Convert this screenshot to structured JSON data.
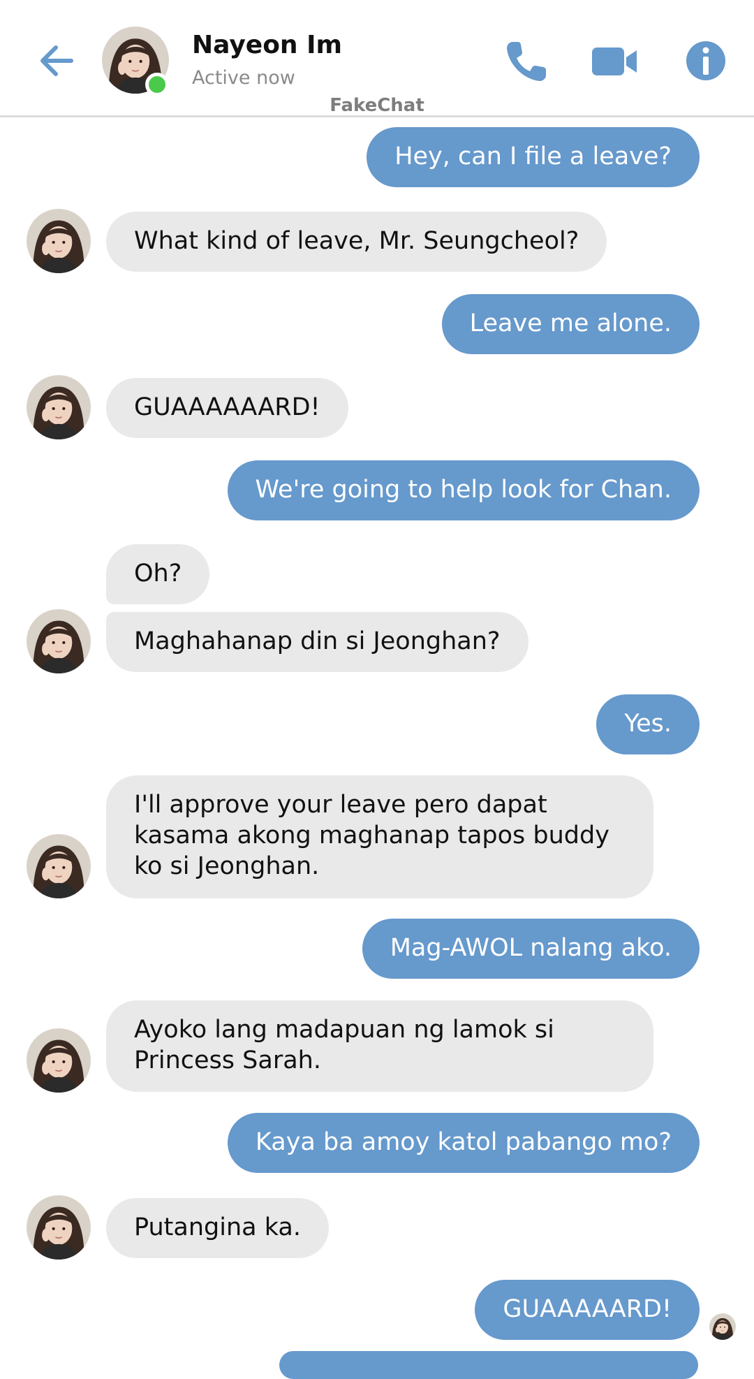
{
  "header": {
    "contact_name": "Nayeon Im",
    "status": "Active now",
    "watermark": "FakeChat",
    "icons": {
      "back": "arrow-left-icon",
      "call": "phone-icon",
      "video": "video-camera-icon",
      "info": "info-icon"
    }
  },
  "colors": {
    "accent": "#6699cc",
    "incoming_bubble": "#e9e9e9",
    "online": "#4bc94b"
  },
  "messages": [
    {
      "dir": "out",
      "text": "Hey, can I file a leave?"
    },
    {
      "dir": "in",
      "text": "What kind of leave, Mr. Seungcheol?"
    },
    {
      "dir": "out",
      "text": "Leave me alone."
    },
    {
      "dir": "in",
      "text": "GUAAAAAARD!"
    },
    {
      "dir": "out",
      "text": "We're going to help look for Chan."
    },
    {
      "dir": "in",
      "text": "Oh?"
    },
    {
      "dir": "in",
      "text": "Maghahanap din si Jeonghan?"
    },
    {
      "dir": "out",
      "text": "Yes."
    },
    {
      "dir": "in",
      "text": "I'll approve your leave pero dapat kasama akong maghanap tapos buddy ko si Jeonghan."
    },
    {
      "dir": "out",
      "text": "Mag-AWOL nalang ako."
    },
    {
      "dir": "in",
      "text": "Ayoko lang madapuan ng lamok si Princess Sarah."
    },
    {
      "dir": "out",
      "text": "Kaya ba amoy katol pabango mo?"
    },
    {
      "dir": "in",
      "text": "Putangina ka."
    },
    {
      "dir": "out",
      "text": "GUAAAAARD!"
    }
  ]
}
